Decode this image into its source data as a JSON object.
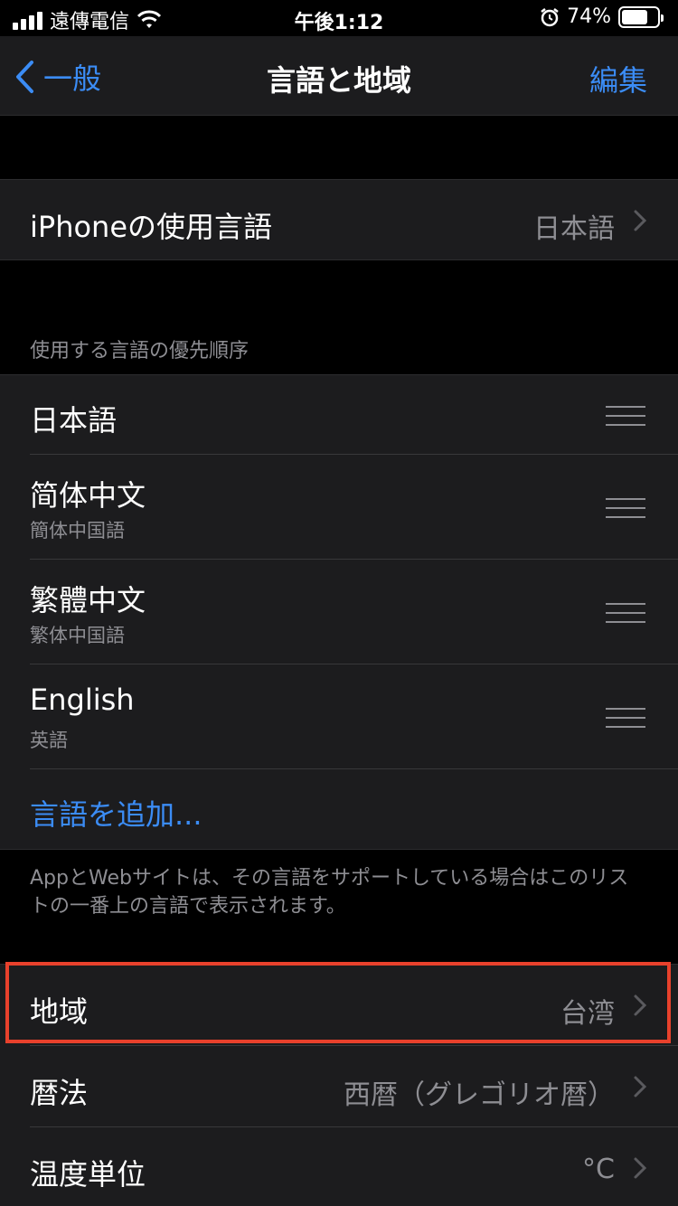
{
  "status_bar": {
    "carrier": "遠傳電信",
    "time": "午後1:12",
    "battery_percent": "74%",
    "battery_level": 0.74
  },
  "nav": {
    "back_label": "一般",
    "title": "言語と地域",
    "edit_label": "編集"
  },
  "iphone_language": {
    "label": "iPhoneの使用言語",
    "value": "日本語"
  },
  "preferred_languages": {
    "header": "使用する言語の優先順序",
    "items": [
      {
        "label": "日本語",
        "sub": ""
      },
      {
        "label": "简体中文",
        "sub": "簡体中国語"
      },
      {
        "label": "繁體中文",
        "sub": "繁体中国語"
      },
      {
        "label": "English",
        "sub": "英語"
      }
    ],
    "add_label": "言語を追加...",
    "footer": "AppとWebサイトは、その言語をサポートしている場合はこのリストの一番上の言語で表示されます。"
  },
  "region_settings": {
    "region": {
      "label": "地域",
      "value": "台湾"
    },
    "calendar": {
      "label": "暦法",
      "value": "西暦（グレゴリオ暦）"
    },
    "temperature": {
      "label": "温度単位",
      "value": "°C"
    }
  },
  "colors": {
    "accent": "#3b8cf5",
    "highlight": "#e8412c",
    "background": "#000000",
    "cell": "#1c1c1e"
  }
}
